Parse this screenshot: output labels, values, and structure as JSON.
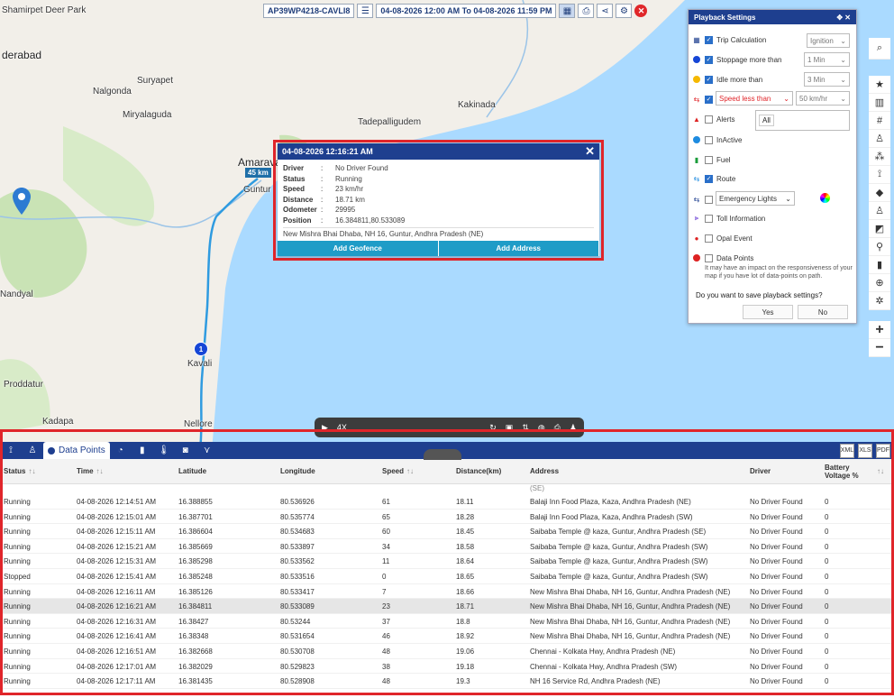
{
  "toolbar": {
    "vehicle": "AP39WP4218-CAVLI8",
    "date_range": "04-08-2026 12:00 AM To 04-08-2026 11:59 PM"
  },
  "map": {
    "labels": [
      "Shamirpet Deer Park",
      "derabad",
      "Suryapet",
      "Nalgonda",
      "Miryalaguda",
      "Kakinada",
      "Tadepalligudem",
      "Amaravati",
      "Guntur",
      "Nandyal",
      "Kavali",
      "Proddatur",
      "Kadapa",
      "Nellore"
    ],
    "speed_badge": "45 km",
    "marker_number": "1"
  },
  "popup": {
    "title": "04-08-2026 12:16:21 AM",
    "fields": [
      {
        "k": "Driver",
        "v": "No Driver Found"
      },
      {
        "k": "Status",
        "v": "Running"
      },
      {
        "k": "Speed",
        "v": "23 km/hr"
      },
      {
        "k": "Distance",
        "v": "18.71 km"
      },
      {
        "k": "Odometer",
        "v": "29995"
      },
      {
        "k": "Position",
        "v": "16.384811,80.533089"
      }
    ],
    "address": "New Mishra Bhai Dhaba, NH 16, Guntur, Andhra Pradesh (NE)",
    "add_geofence": "Add Geofence",
    "add_address": "Add Address"
  },
  "settings": {
    "title": "Playback Settings",
    "rows": [
      {
        "label": "Trip Calculation",
        "checked": true,
        "select": "Ignition"
      },
      {
        "label": "Stoppage more than",
        "checked": true,
        "select": "1 Min"
      },
      {
        "label": "Idle more than",
        "checked": true,
        "select": "3 Min"
      },
      {
        "label": "Speed less than",
        "checked": true,
        "select": "50 km/hr"
      },
      {
        "label": "Alerts",
        "checked": false,
        "select": "All"
      },
      {
        "label": "InActive",
        "checked": false
      },
      {
        "label": "Fuel",
        "checked": false
      },
      {
        "label": "Route",
        "checked": true
      },
      {
        "label": "Emergency Lights",
        "checked": false
      },
      {
        "label": "Toll Information",
        "checked": false
      },
      {
        "label": "Opal Event",
        "checked": false
      },
      {
        "label": "Data Points",
        "checked": false
      }
    ],
    "note": "It may have an impact on the responsiveness of your map if you have lot of data-points on path.",
    "question": "Do you want to save playback settings?",
    "yes": "Yes",
    "no": "No"
  },
  "playbar": {
    "speed": "4X"
  },
  "bottom": {
    "active_tab": "Data Points",
    "export": [
      "XML",
      "XLS",
      "PDF"
    ],
    "columns": [
      "Status",
      "Time",
      "Latitude",
      "Longitude",
      "Speed",
      "Distance(km)",
      "Address",
      "Driver",
      "Battery Voltage %"
    ],
    "partial_top": "(SE)",
    "rows": [
      [
        "Running",
        "04-08-2026 12:14:51 AM",
        "16.388855",
        "80.536926",
        "61",
        "18.11",
        "Balaji Inn Food Plaza, Kaza, Andhra Pradesh (NE)",
        "No Driver Found",
        "0"
      ],
      [
        "Running",
        "04-08-2026 12:15:01 AM",
        "16.387701",
        "80.535774",
        "65",
        "18.28",
        "Balaji Inn Food Plaza, Kaza, Andhra Pradesh (SW)",
        "No Driver Found",
        "0"
      ],
      [
        "Running",
        "04-08-2026 12:15:11 AM",
        "16.386604",
        "80.534683",
        "60",
        "18.45",
        "Saibaba Temple @ kaza, Guntur, Andhra Pradesh (SE)",
        "No Driver Found",
        "0"
      ],
      [
        "Running",
        "04-08-2026 12:15:21 AM",
        "16.385669",
        "80.533897",
        "34",
        "18.58",
        "Saibaba Temple @ kaza, Guntur, Andhra Pradesh (SW)",
        "No Driver Found",
        "0"
      ],
      [
        "Running",
        "04-08-2026 12:15:31 AM",
        "16.385298",
        "80.533562",
        "11",
        "18.64",
        "Saibaba Temple @ kaza, Guntur, Andhra Pradesh (SW)",
        "No Driver Found",
        "0"
      ],
      [
        "Stopped",
        "04-08-2026 12:15:41 AM",
        "16.385248",
        "80.533516",
        "0",
        "18.65",
        "Saibaba Temple @ kaza, Guntur, Andhra Pradesh (SW)",
        "No Driver Found",
        "0"
      ],
      [
        "Running",
        "04-08-2026 12:16:11 AM",
        "16.385126",
        "80.533417",
        "7",
        "18.66",
        "New Mishra Bhai Dhaba, NH 16, Guntur, Andhra Pradesh (NE)",
        "No Driver Found",
        "0"
      ],
      [
        "Running",
        "04-08-2026 12:16:21 AM",
        "16.384811",
        "80.533089",
        "23",
        "18.71",
        "New Mishra Bhai Dhaba, NH 16, Guntur, Andhra Pradesh (NE)",
        "No Driver Found",
        "0"
      ],
      [
        "Running",
        "04-08-2026 12:16:31 AM",
        "16.38427",
        "80.53244",
        "37",
        "18.8",
        "New Mishra Bhai Dhaba, NH 16, Guntur, Andhra Pradesh (NE)",
        "No Driver Found",
        "0"
      ],
      [
        "Running",
        "04-08-2026 12:16:41 AM",
        "16.38348",
        "80.531654",
        "46",
        "18.92",
        "New Mishra Bhai Dhaba, NH 16, Guntur, Andhra Pradesh (NE)",
        "No Driver Found",
        "0"
      ],
      [
        "Running",
        "04-08-2026 12:16:51 AM",
        "16.382668",
        "80.530708",
        "48",
        "19.06",
        "Chennai - Kolkata Hwy, Andhra Pradesh (NE)",
        "No Driver Found",
        "0"
      ],
      [
        "Running",
        "04-08-2026 12:17:01 AM",
        "16.382029",
        "80.529823",
        "38",
        "19.18",
        "Chennai - Kolkata Hwy, Andhra Pradesh (SW)",
        "No Driver Found",
        "0"
      ],
      [
        "Running",
        "04-08-2026 12:17:11 AM",
        "16.381435",
        "80.528908",
        "48",
        "19.3",
        "NH 16 Service Rd, Andhra Pradesh (NE)",
        "No Driver Found",
        "0"
      ]
    ],
    "highlight_index": 7
  },
  "colors": {
    "brand": "#1e3f8f",
    "accent": "#1f9cc7",
    "outline": "#e0252a",
    "route": "#2f9be0"
  }
}
